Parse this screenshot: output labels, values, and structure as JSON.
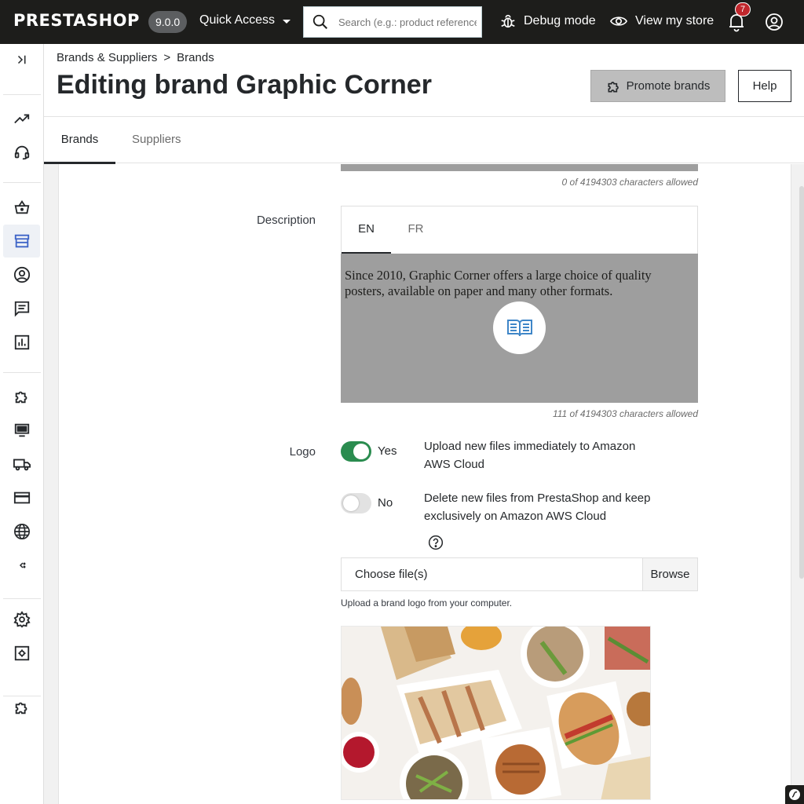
{
  "topbar": {
    "logo": "PRESTASHOP",
    "version": "9.0.0",
    "quick_access": "Quick Access",
    "search_placeholder": "Search (e.g.: product reference)",
    "debug_mode": "Debug mode",
    "view_store": "View my store",
    "notifications_count": "7"
  },
  "breadcrumb": {
    "parent": "Brands & Suppliers",
    "separator": ">",
    "current": "Brands"
  },
  "page": {
    "title": "Editing brand Graphic Corner",
    "promote_label": "Promote brands",
    "help_label": "Help"
  },
  "tabs": [
    "Brands",
    "Suppliers"
  ],
  "form": {
    "short_desc_counter": "0 of 4194303 characters allowed",
    "description_label": "Description",
    "lang_tabs": [
      "EN",
      "FR"
    ],
    "description_text": "Since 2010, Graphic Corner offers a large choice of quality posters, available on paper and many other formats.",
    "description_counter": "111 of 4194303 characters allowed",
    "logo_label": "Logo",
    "option_yes": "Yes",
    "option_yes_desc": "Upload new files immediately to Amazon AWS Cloud",
    "option_no": "No",
    "option_no_desc": "Delete new files from PrestaShop and keep exclusively on Amazon AWS Cloud",
    "file_placeholder": "Choose file(s)",
    "browse_label": "Browse",
    "file_help": "Upload a brand logo from your computer."
  },
  "colors": {
    "topbar": "#1d1d1b",
    "toggle_on": "#2a8c4f",
    "badge": "#c1272d",
    "active_icon": "#3e64c7"
  },
  "icons": {
    "sidebar": [
      "collapse-icon",
      "trending-icon",
      "headset-icon",
      "basket-icon",
      "store-icon",
      "user-icon",
      "message-icon",
      "stats-icon",
      "puzzle-icon",
      "monitor-icon",
      "truck-icon",
      "credit-card-icon",
      "globe-icon",
      "chevron-icon",
      "gear-icon",
      "settings-box-icon",
      "puzzle-icon"
    ]
  }
}
